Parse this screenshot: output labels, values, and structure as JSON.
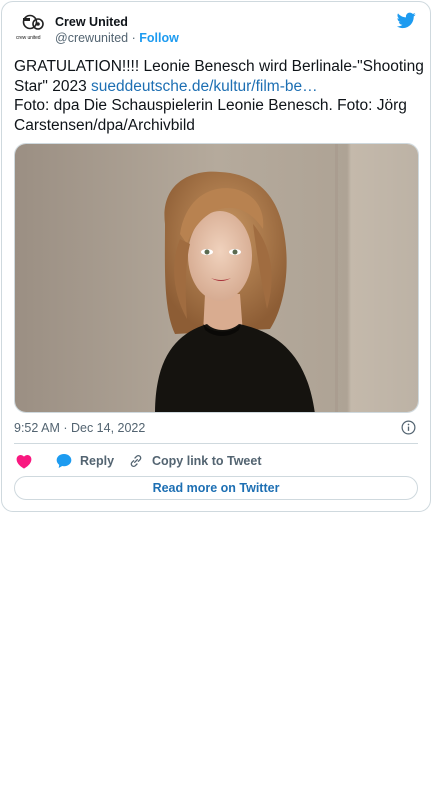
{
  "colors": {
    "brand_blue": "#1d9bf0",
    "link_blue": "#1d6fb3",
    "text": "#0f1419",
    "muted": "#536471",
    "border": "#cfd9de",
    "heart_red": "#f91880"
  },
  "author": {
    "avatar_text": "crew united",
    "name": "Crew United",
    "handle": "@crewunited",
    "separator": "·",
    "follow_label": "Follow"
  },
  "tweet": {
    "text_line1": "GRATULATION!!!! Leonie Benesch wird Berlinale-\"Shooting Star\" 2023 ",
    "link_text": "sueddeutsche.de/kultur/film-be…",
    "text_line2": "Foto: dpa Die Schauspielerin Leonie Benesch. Foto: Jörg Carstensen/dpa/Archivbild",
    "timestamp": "9:52 AM · Dec 14, 2022"
  },
  "actions": {
    "like_icon": "heart-icon",
    "reply_icon": "speech-bubble-icon",
    "reply_label": "Reply",
    "copy_icon": "link-icon",
    "copy_label": "Copy link to Tweet",
    "info_icon": "info-icon"
  },
  "footer": {
    "read_more_label": "Read more on Twitter"
  }
}
